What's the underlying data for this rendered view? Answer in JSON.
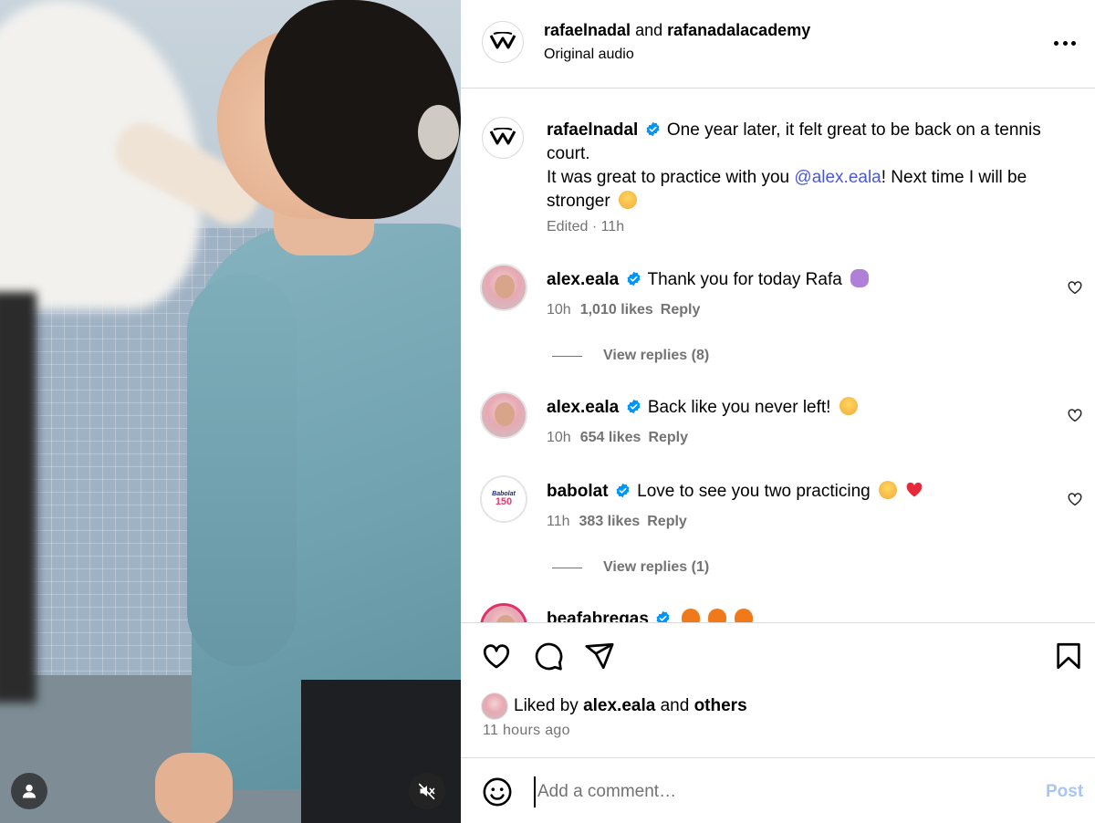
{
  "header": {
    "author": "rafaelnadal",
    "joiner": "and",
    "coauthor": "rafanadalacademy",
    "audio": "Original audio"
  },
  "caption": {
    "username": "rafaelnadal",
    "text_1": "One year later, it felt great to be back on a tennis court.",
    "text_2": "It was great to practice with you",
    "mention": "@alex.eala",
    "text_3": "! Next time I will be stronger",
    "edited": "Edited",
    "time": "11h"
  },
  "comments": [
    {
      "username": "alex.eala",
      "text": "Thank you for today Rafa",
      "time": "10h",
      "likes": "1,010 likes",
      "reply": "Reply"
    },
    {
      "username": "alex.eala",
      "text": "Back like you never left!",
      "time": "10h",
      "likes": "654 likes",
      "reply": "Reply"
    },
    {
      "username": "babolat",
      "text": "Love to see you two practicing",
      "time": "11h",
      "likes": "383 likes",
      "reply": "Reply"
    },
    {
      "username": "beafabregas",
      "text": ""
    }
  ],
  "view_replies": [
    "View replies (8)",
    "View replies (1)"
  ],
  "babolat_logo": {
    "line1": "Babolat",
    "line2": "150"
  },
  "likes": {
    "prefix": "Liked by",
    "user": "alex.eala",
    "joiner": "and",
    "others": "others"
  },
  "timestamp": "11 hours ago",
  "add_comment": {
    "placeholder": "Add a comment…",
    "post_label": "Post"
  },
  "colors": {
    "link": "#4b59d6",
    "verified": "#0095f6",
    "muted": "#737373",
    "post_disabled": "#a8c5f7",
    "border": "#dbdbdb"
  },
  "icons": [
    "user-tag-icon",
    "muted-speaker-icon",
    "more-options-icon",
    "verified-badge-icon",
    "heart-icon",
    "comment-icon",
    "share-icon",
    "bookmark-icon",
    "emoji-icon"
  ]
}
